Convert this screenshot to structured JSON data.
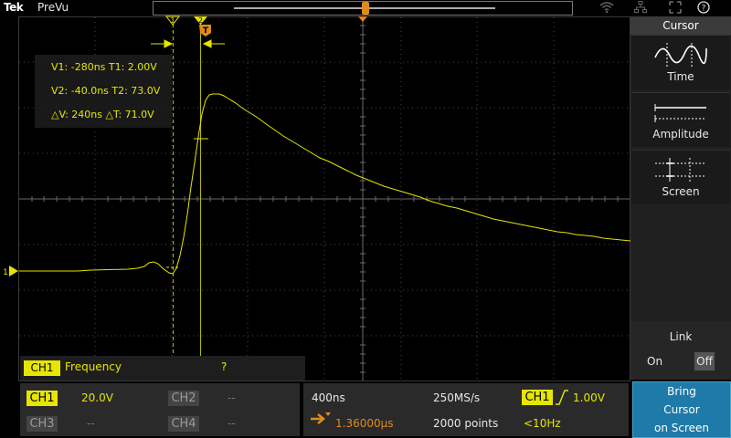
{
  "header": {
    "logo": "Tek",
    "status": "PreVu"
  },
  "cursor_readout": {
    "line1": "V1: -280ns  T1: 2.00V",
    "line2": "V2: -40.0ns  T2: 73.0V",
    "line3": "△V: 240ns  △T: 71.0V"
  },
  "measurement": {
    "channel": "CH1",
    "name": "Frequency",
    "value": "?"
  },
  "cursor_panel": {
    "title": "Cursor",
    "options": [
      {
        "label": "Time",
        "icon": "time-cursor-icon"
      },
      {
        "label": "Amplitude",
        "icon": "amplitude-cursor-icon"
      },
      {
        "label": "Screen",
        "icon": "screen-cursor-icon"
      }
    ],
    "link_label": "Link",
    "link_on": "On",
    "link_off": "Off",
    "link_selected": "Off"
  },
  "channels": {
    "ch1_label": "CH1",
    "ch1_scale": "20.0V",
    "ch2_label": "CH2",
    "ch2_scale": "--",
    "ch3_label": "CH3",
    "ch3_scale": "--",
    "ch4_label": "CH4",
    "ch4_scale": "--"
  },
  "horizontal": {
    "time_div": "400ns",
    "sample_rate": "250MS/s",
    "position": "1.36000µs",
    "record_length": "2000 points"
  },
  "trigger": {
    "source": "CH1",
    "level": "1.00V",
    "freq": "<10Hz"
  },
  "bring_button": {
    "line1": "Bring",
    "line2": "Cursor",
    "line3": "on Screen"
  },
  "markers": {
    "cursor1": "1",
    "cursor2": "2",
    "trigger": "T",
    "ch1_ground": "1"
  },
  "colors": {
    "ch1": "#e6e600",
    "accent": "#1e7aa8",
    "trigger_marker": "#e08a1e"
  }
}
